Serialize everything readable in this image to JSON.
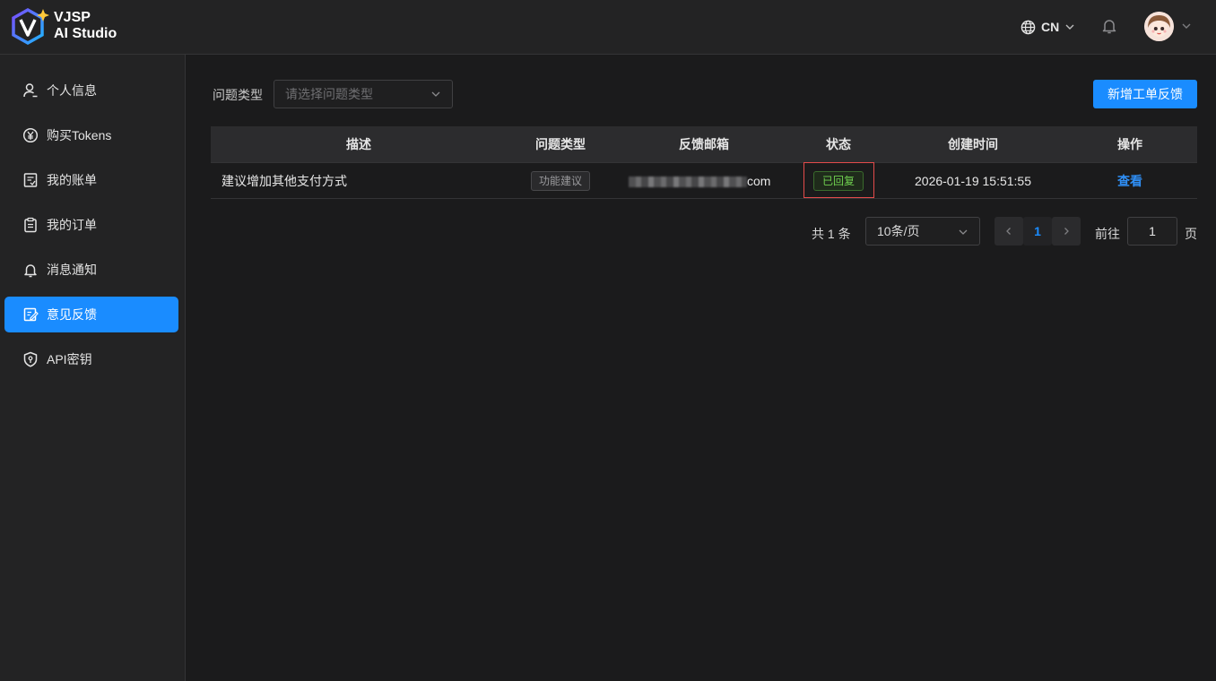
{
  "brand": {
    "line1": "VJSP",
    "line2": "AI Studio"
  },
  "header": {
    "language": "CN"
  },
  "sidebar": {
    "items": [
      {
        "label": "个人信息",
        "icon": "user-icon"
      },
      {
        "label": "购买Tokens",
        "icon": "yen-coin-icon"
      },
      {
        "label": "我的账单",
        "icon": "bill-icon"
      },
      {
        "label": "我的订单",
        "icon": "clipboard-icon"
      },
      {
        "label": "消息通知",
        "icon": "bell-icon"
      },
      {
        "label": "意见反馈",
        "icon": "edit-note-icon",
        "active": true
      },
      {
        "label": "API密钥",
        "icon": "shield-key-icon"
      }
    ]
  },
  "filter": {
    "label": "问题类型",
    "placeholder": "请选择问题类型"
  },
  "actions": {
    "new_ticket": "新增工单反馈"
  },
  "table": {
    "headers": [
      "描述",
      "问题类型",
      "反馈邮箱",
      "状态",
      "创建时间",
      "操作"
    ],
    "rows": [
      {
        "description": "建议增加其他支付方式",
        "type": "功能建议",
        "email_visible_suffix": "com",
        "status": "已回复",
        "created": "2026-01-19 15:51:55",
        "action": "查看"
      }
    ]
  },
  "pagination": {
    "total_text": "共 1 条",
    "page_size": "10条/页",
    "current_page": "1",
    "goto_label": "前往",
    "goto_value": "1",
    "page_suffix": "页"
  },
  "colors": {
    "accent": "#1a8cff",
    "status_green": "#6fcf4f",
    "highlight_red": "#e44b4b"
  }
}
